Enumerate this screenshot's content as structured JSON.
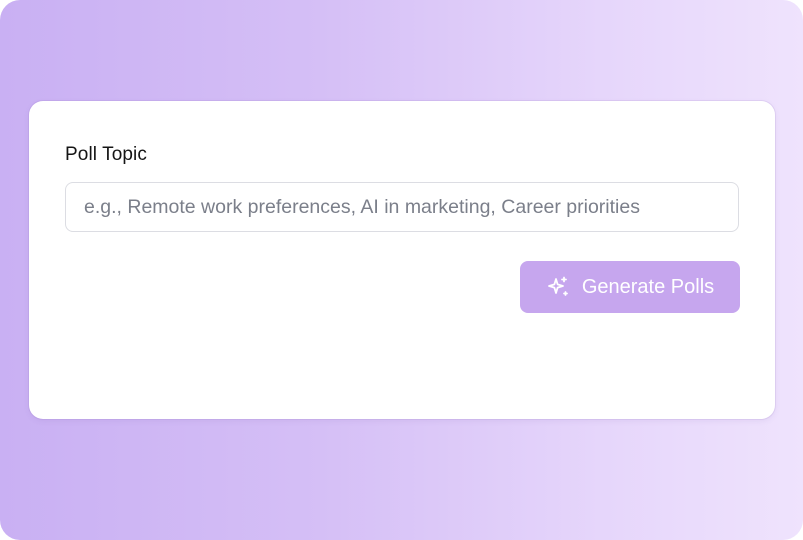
{
  "form": {
    "label": "Poll Topic",
    "input_value": "",
    "input_placeholder": "e.g., Remote work preferences, AI in marketing, Career priorities",
    "button_label": "Generate Polls",
    "button_icon": "sparkles-icon"
  },
  "colors": {
    "background_gradient_start": "#c9b0f3",
    "background_gradient_end": "#efe3fd",
    "button_background": "#c6a6ee",
    "button_text": "#ffffff"
  }
}
